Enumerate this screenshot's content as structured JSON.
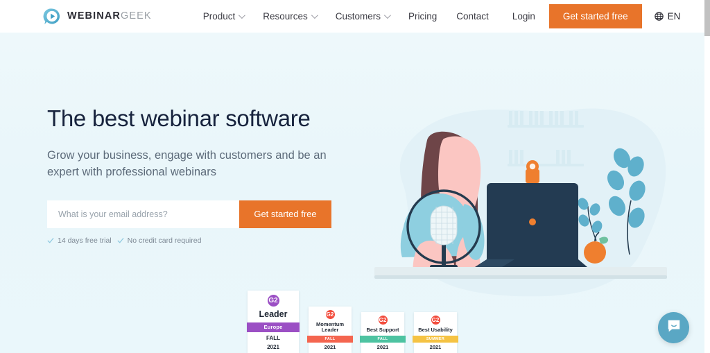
{
  "header": {
    "logo": {
      "bold": "WEBINAR",
      "light": "GEEK",
      "icon": "play-bubble-icon"
    },
    "nav": [
      {
        "label": "Product",
        "caret": true
      },
      {
        "label": "Resources",
        "caret": true
      },
      {
        "label": "Customers",
        "caret": true
      },
      {
        "label": "Pricing",
        "caret": false
      },
      {
        "label": "Contact",
        "caret": false
      }
    ],
    "login_label": "Login",
    "cta_label": "Get started free",
    "language": "EN"
  },
  "hero": {
    "title": "The best webinar software",
    "subtitle": "Grow your business, engage with customers and be an expert with professional webinars",
    "email_placeholder": "What is your email address?",
    "email_value": "",
    "submit_label": "Get started free",
    "trust": [
      "14 days free trial",
      "No credit card required"
    ]
  },
  "badges": [
    {
      "size": "lead",
      "mark": "G2",
      "mark_color": "#9b4fc4",
      "title": "Leader",
      "ribbon": "Europe",
      "ribbon_color": "#9b4fc4",
      "foot_line1": "FALL",
      "foot_line2": "2021"
    },
    {
      "size": "small",
      "mark": "G2",
      "mark_color": "#f24c3d",
      "title": "Momentum Leader",
      "ribbon": "FALL",
      "ribbon_color": "#f4654f",
      "foot_line1": "2021",
      "foot_line2": ""
    },
    {
      "size": "small",
      "mark": "G2",
      "mark_color": "#f24c3d",
      "title": "Best Support",
      "ribbon": "FALL",
      "ribbon_color": "#4dc3a1",
      "foot_line1": "2021",
      "foot_line2": ""
    },
    {
      "size": "small",
      "mark": "G2",
      "mark_color": "#f24c3d",
      "title": "Best Usability",
      "ribbon": "SUMMER",
      "ribbon_color": "#f5c344",
      "foot_line1": "2021",
      "foot_line2": ""
    }
  ],
  "chat": {
    "icon": "chat-bubble-icon",
    "color": "#5aa7c4"
  },
  "colors": {
    "accent_orange": "#e8742a",
    "hero_background": "#eaf7fb",
    "heading_navy": "#17233d",
    "body_grey": "#5d6b7a"
  }
}
